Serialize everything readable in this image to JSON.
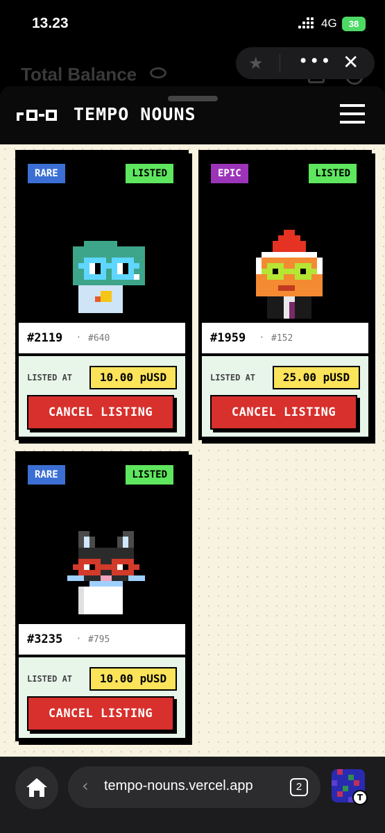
{
  "status_bar": {
    "time": "13.23",
    "network": "4G",
    "battery": "38"
  },
  "background_app": {
    "title": "Total Balance"
  },
  "browser_chrome": {
    "star_icon": "star-icon",
    "more_icon": "more-icon",
    "close_icon": "close-icon"
  },
  "header": {
    "logo_text": "TEMPO NOUNS",
    "menu_icon": "hamburger-icon"
  },
  "cards": [
    {
      "rarity": "RARE",
      "rarity_color": "#3b6fd4",
      "status": "LISTED",
      "id": "#2119",
      "sub_id": "#640",
      "listed_label": "LISTED AT",
      "price": "10.00 pUSD",
      "button": "CANCEL LISTING"
    },
    {
      "rarity": "EPIC",
      "rarity_color": "#9b34b8",
      "status": "LISTED",
      "id": "#1959",
      "sub_id": "#152",
      "listed_label": "LISTED AT",
      "price": "25.00 pUSD",
      "button": "CANCEL LISTING"
    },
    {
      "rarity": "RARE",
      "rarity_color": "#3b6fd4",
      "status": "LISTED",
      "id": "#3235",
      "sub_id": "#795",
      "listed_label": "LISTED AT",
      "price": "10.00 pUSD",
      "button": "CANCEL LISTING"
    }
  ],
  "bottom_bar": {
    "url": "tempo-nouns.vercel.app",
    "tab_count": "2",
    "badge": "T"
  }
}
